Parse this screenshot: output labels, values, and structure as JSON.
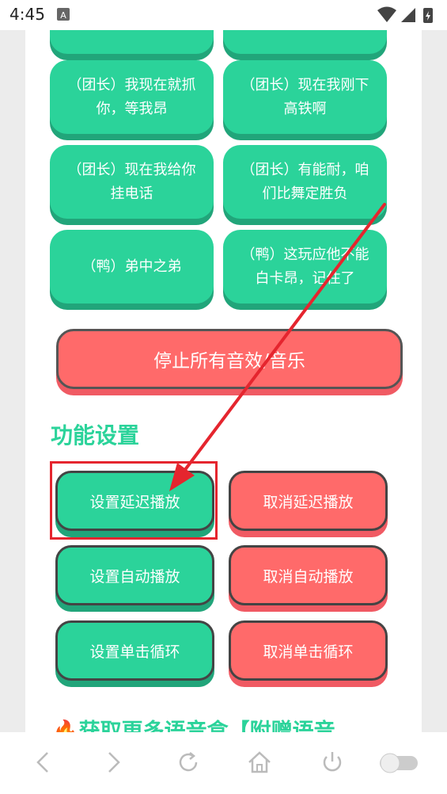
{
  "status_bar": {
    "time": "4:45"
  },
  "sound_buttons": [
    {
      "label": ""
    },
    {
      "label": ""
    },
    {
      "label": "（团长）我现在就抓你，等我昂"
    },
    {
      "label": "（团长）现在我刚下高铁啊"
    },
    {
      "label": "（团长）现在我给你挂电话"
    },
    {
      "label": "（团长）有能耐，咱们比舞定胜负"
    },
    {
      "label": "（鸭）弟中之弟"
    },
    {
      "label": "（鸭）这玩应他不能白卡昂，记住了"
    }
  ],
  "stop_button": {
    "label": "停止所有音效/音乐"
  },
  "settings": {
    "title": "功能设置",
    "buttons": [
      {
        "set_label": "设置延迟播放",
        "cancel_label": "取消延迟播放"
      },
      {
        "set_label": "设置自动播放",
        "cancel_label": "取消自动播放"
      },
      {
        "set_label": "设置单击循环",
        "cancel_label": "取消单击循环"
      }
    ]
  },
  "more_section": {
    "title": "获取更多语音盒【附赠语音"
  },
  "colors": {
    "green": "#2bd39a",
    "red": "#ff6a6a",
    "annotation_red": "#e5252e"
  }
}
